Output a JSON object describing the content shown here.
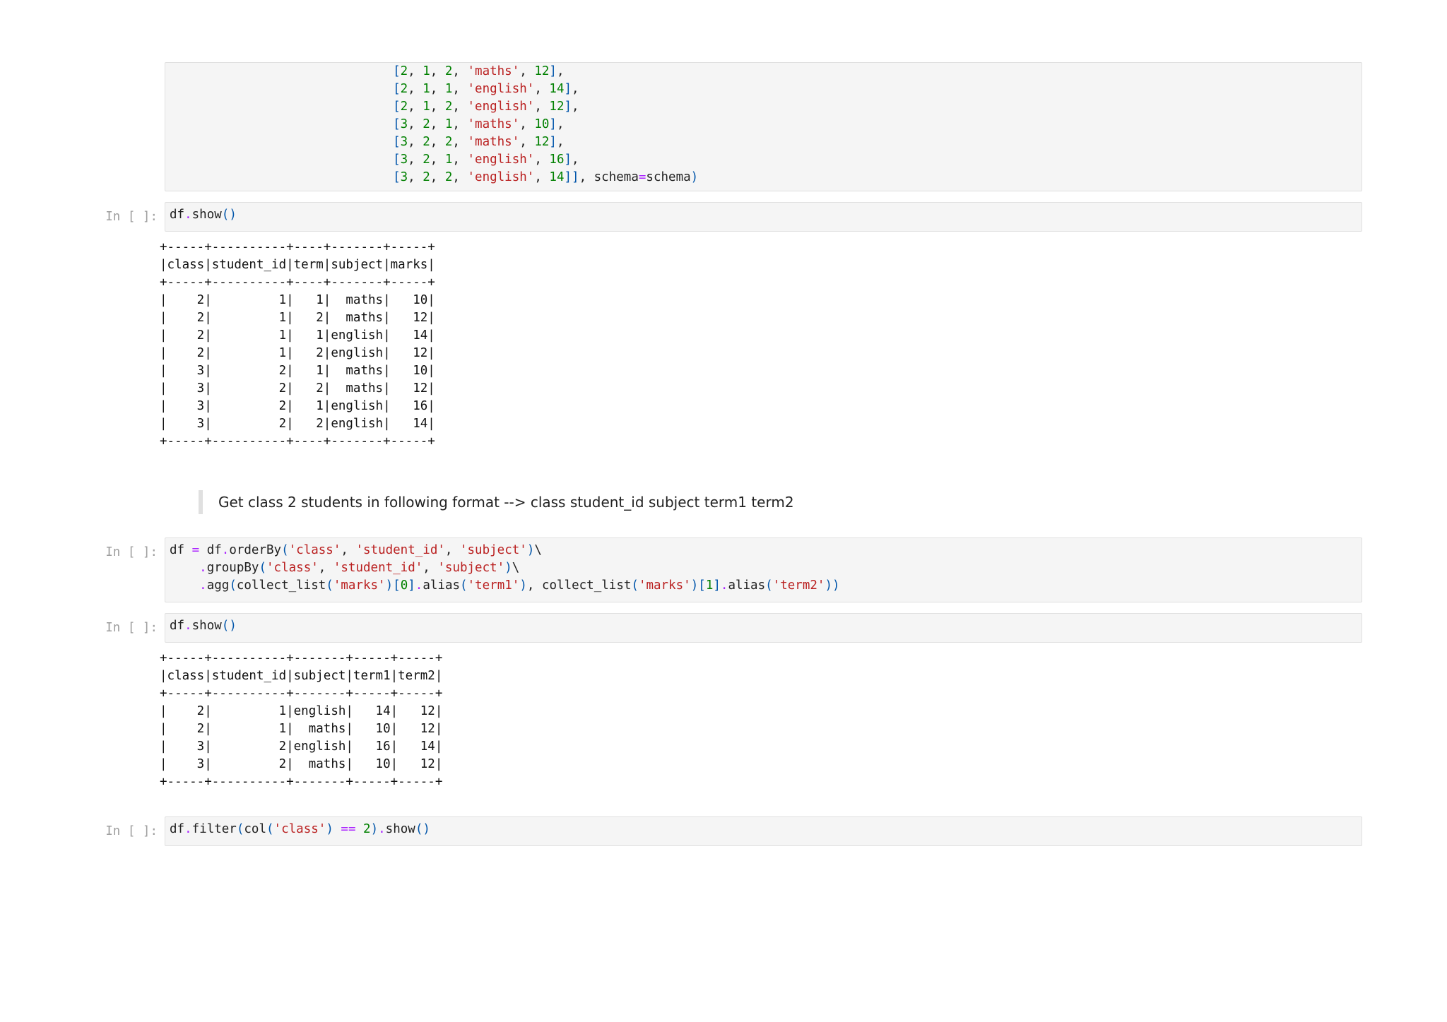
{
  "cell1_lines": [
    "                              [2, 1, 2, 'maths', 12],",
    "                              [2, 1, 1, 'english', 14],",
    "                              [2, 1, 2, 'english', 12],",
    "                              [3, 2, 1, 'maths', 10],",
    "                              [3, 2, 2, 'maths', 12],",
    "                              [3, 2, 1, 'english', 16],",
    "                              [3, 2, 2, 'english', 14]], schema=schema)"
  ],
  "prompts": {
    "cell2": "In [ ]:",
    "cell3": "In [ ]:",
    "cell4": "In [ ]:",
    "cell5": "In [ ]:"
  },
  "cell2_code": "df.show()",
  "output1": "+-----+----------+----+-------+-----+\n|class|student_id|term|subject|marks|\n+-----+----------+----+-------+-----+\n|    2|         1|   1|  maths|   10|\n|    2|         1|   2|  maths|   12|\n|    2|         1|   1|english|   14|\n|    2|         1|   2|english|   12|\n|    3|         2|   1|  maths|   10|\n|    3|         2|   2|  maths|   12|\n|    3|         2|   1|english|   16|\n|    3|         2|   2|english|   14|\n+-----+----------+----+-------+-----+",
  "markdown_text": "Get class 2 students in following format --> class student_id subject term1 term2",
  "cell3_lines": [
    "df = df.orderBy('class', 'student_id', 'subject')\\",
    "    .groupBy('class', 'student_id', 'subject')\\",
    "    .agg(collect_list('marks')[0].alias('term1'), collect_list('marks')[1].alias('term2'))"
  ],
  "cell4_code": "df.show()",
  "output2": "+-----+----------+-------+-----+-----+\n|class|student_id|subject|term1|term2|\n+-----+----------+-------+-----+-----+\n|    2|         1|english|   14|   12|\n|    2|         1|  maths|   10|   12|\n|    3|         2|english|   16|   14|\n|    3|         2|  maths|   10|   12|\n+-----+----------+-------+-----+-----+",
  "cell5_code": "df.filter(col('class') == 2).show()"
}
